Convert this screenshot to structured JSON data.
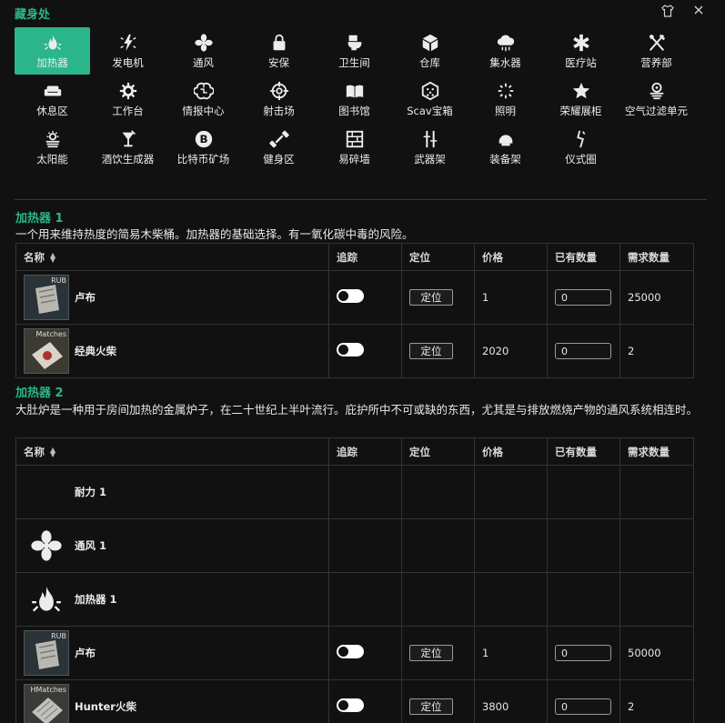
{
  "window": {
    "title": "藏身处",
    "shirt_icon": "shirt-icon",
    "close_icon": "close-icon"
  },
  "stations": [
    {
      "label": "加热器",
      "icon": "fire-icon",
      "active": true
    },
    {
      "label": "发电机",
      "icon": "generator-icon"
    },
    {
      "label": "通风",
      "icon": "fan-icon"
    },
    {
      "label": "安保",
      "icon": "lock-icon"
    },
    {
      "label": "卫生间",
      "icon": "toilet-icon"
    },
    {
      "label": "仓库",
      "icon": "box-icon"
    },
    {
      "label": "集水器",
      "icon": "water-cloud-icon"
    },
    {
      "label": "医疗站",
      "icon": "medical-icon"
    },
    {
      "label": "营养部",
      "icon": "utensils-icon"
    },
    {
      "label": "休息区",
      "icon": "sofa-icon"
    },
    {
      "label": "工作台",
      "icon": "gear-icon"
    },
    {
      "label": "情报中心",
      "icon": "brain-icon"
    },
    {
      "label": "射击场",
      "icon": "crosshair-icon"
    },
    {
      "label": "图书馆",
      "icon": "book-icon"
    },
    {
      "label": "Scav宝箱",
      "icon": "dice-icon"
    },
    {
      "label": "照明",
      "icon": "light-icon"
    },
    {
      "label": "荣耀展柜",
      "icon": "star-icon"
    },
    {
      "label": "空气过滤单元",
      "icon": "air-filter-icon"
    },
    {
      "label": "太阳能",
      "icon": "sun-icon"
    },
    {
      "label": "酒饮生成器",
      "icon": "drink-icon"
    },
    {
      "label": "比特币矿场",
      "icon": "bitcoin-icon"
    },
    {
      "label": "健身区",
      "icon": "dumbbell-icon"
    },
    {
      "label": "易碎墙",
      "icon": "wall-icon"
    },
    {
      "label": "武器架",
      "icon": "weapon-rack-icon"
    },
    {
      "label": "装备架",
      "icon": "helmet-icon"
    },
    {
      "label": "仪式圈",
      "icon": "ritual-icon"
    }
  ],
  "columns": {
    "name": "名称",
    "track": "追踪",
    "locate": "定位",
    "price": "价格",
    "have": "已有数量",
    "need": "需求数量"
  },
  "sections": [
    {
      "title": "加热器 1",
      "description": "一个用来维持热度的简易木柴桶。加热器的基础选择。有一氧化碳中毒的风险。",
      "rows": [
        {
          "name": "卢布",
          "thumb": "roubles",
          "thumb_tag": "RUB",
          "price": "1",
          "have": "0",
          "need": "25000",
          "locate": "定位"
        },
        {
          "name": "经典火柴",
          "thumb": "matches",
          "thumb_tag": "Matches",
          "price": "2020",
          "have": "0",
          "need": "2",
          "locate": "定位"
        }
      ]
    },
    {
      "title": "加热器 2",
      "description": "大肚炉是一种用于房间加热的金属炉子，在二十世纪上半叶流行。庇护所中不可或缺的东西，尤其是与排放燃烧产物的通风系统相连时。",
      "rows": [
        {
          "name": "耐力 1",
          "icon": "none"
        },
        {
          "name": "通风 1",
          "icon": "fan-icon"
        },
        {
          "name": "加热器 1",
          "icon": "fire-icon"
        },
        {
          "name": "卢布",
          "thumb": "roubles",
          "thumb_tag": "RUB",
          "price": "1",
          "have": "0",
          "need": "50000",
          "locate": "定位"
        },
        {
          "name": "Hunter火柴",
          "thumb": "hmatches",
          "thumb_tag": "HMatches",
          "price": "3800",
          "have": "0",
          "need": "2",
          "locate": "定位"
        }
      ]
    }
  ]
}
